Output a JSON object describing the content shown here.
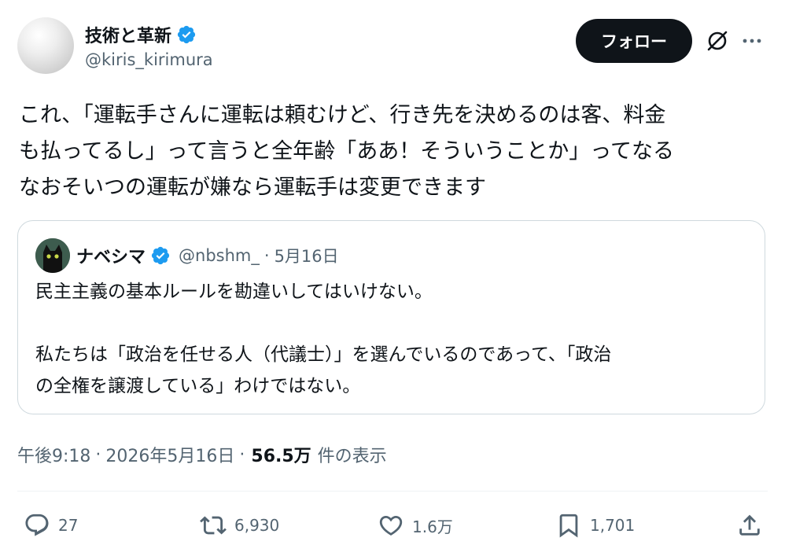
{
  "author": {
    "display_name": "技術と革新",
    "handle": "@kiris_kirimura"
  },
  "follow_label": "フォロー",
  "icons": {
    "verified": "verified-badge-icon",
    "grok": "grok-icon",
    "more": "more-icon",
    "reply": "reply-icon",
    "repost": "repost-icon",
    "like": "like-icon",
    "bookmark": "bookmark-icon",
    "share": "share-icon"
  },
  "tweet": {
    "lines": [
      "これ、「運転手さんに運転は頼むけど、行き先を決めるのは客、料金",
      "も払ってるし」って言うと全年齢「ああ！そういうことか」ってなる",
      "なおそいつの運転が嫌なら運転手は変更できます"
    ]
  },
  "quote": {
    "display_name": "ナベシマ",
    "handle": "@nbshm_",
    "date": "5月16日",
    "text": "民主主義の基本ルールを勘違いしてはいけない。\n\n私たちは「政治を任せる人（代議士）」を選んでいるのであって、「政治\nの全権を譲渡している」わけではない。"
  },
  "meta": {
    "time": "午後9:18",
    "date": "2026年5月16日",
    "views_count": "56.5万",
    "views_label": "件の表示"
  },
  "actions": {
    "reply": "27",
    "repost": "6,930",
    "like": "1.6万",
    "bookmark": "1,701"
  },
  "colors": {
    "text": "#0f1419",
    "secondary": "#536471",
    "verified": "#1d9bf0",
    "follow_bg": "#0f1419",
    "border": "#cfd9de"
  }
}
